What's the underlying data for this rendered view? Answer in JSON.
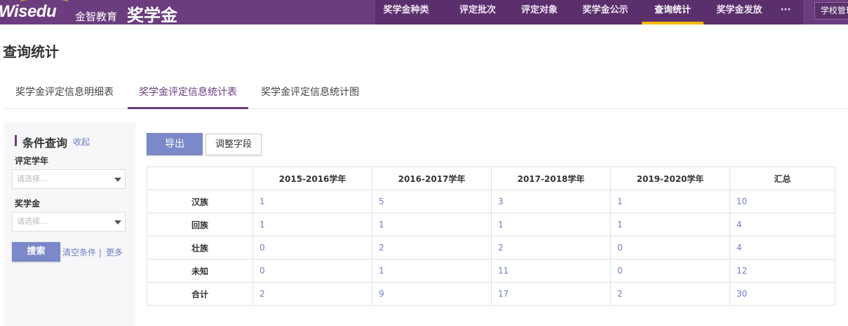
{
  "header": {
    "logo_text": "Wisedu",
    "brand_cn": "金智教育",
    "app_title": "奖学金",
    "nav": [
      {
        "label": "奖学金种类",
        "active": false
      },
      {
        "label": "评定批次",
        "active": false
      },
      {
        "label": "评定对象",
        "active": false
      },
      {
        "label": "奖学金公示",
        "active": false
      },
      {
        "label": "查询统计",
        "active": true
      },
      {
        "label": "奖学金发放",
        "active": false
      },
      {
        "label": "···",
        "active": false
      }
    ],
    "school_button": "学校管理"
  },
  "page": {
    "title": "查询统计",
    "tabs": [
      {
        "label": "奖学金评定信息明细表",
        "active": false
      },
      {
        "label": "奖学金评定信息统计表",
        "active": true
      },
      {
        "label": "奖学金评定信息统计图",
        "active": false
      }
    ]
  },
  "filter": {
    "title": "条件查询",
    "collapse": "收起",
    "year_label": "评定学年",
    "year_placeholder": "请选择...",
    "scholarship_label": "奖学金",
    "scholarship_placeholder": "请选择...",
    "search_button": "搜索",
    "clear_link": "清空条件 |",
    "more_link": "更多"
  },
  "toolbar": {
    "export_label": "导出",
    "fields_label": "调整字段"
  },
  "table": {
    "columns": [
      "",
      "2015-2016学年",
      "2016-2017学年",
      "2017-2018学年",
      "2019-2020学年",
      "汇总"
    ],
    "rows": [
      {
        "label": "汉族",
        "values": [
          "1",
          "5",
          "3",
          "1",
          "10"
        ]
      },
      {
        "label": "回族",
        "values": [
          "1",
          "1",
          "1",
          "1",
          "4"
        ]
      },
      {
        "label": "壮族",
        "values": [
          "0",
          "2",
          "2",
          "0",
          "4"
        ]
      },
      {
        "label": "未知",
        "values": [
          "0",
          "1",
          "11",
          "0",
          "12"
        ]
      },
      {
        "label": "合计",
        "values": [
          "2",
          "9",
          "17",
          "2",
          "30"
        ]
      }
    ]
  },
  "colors": {
    "primary": "#6b3d7e",
    "accent": "#f5b800",
    "button": "#7b88c9",
    "link": "#6b7fc4"
  }
}
